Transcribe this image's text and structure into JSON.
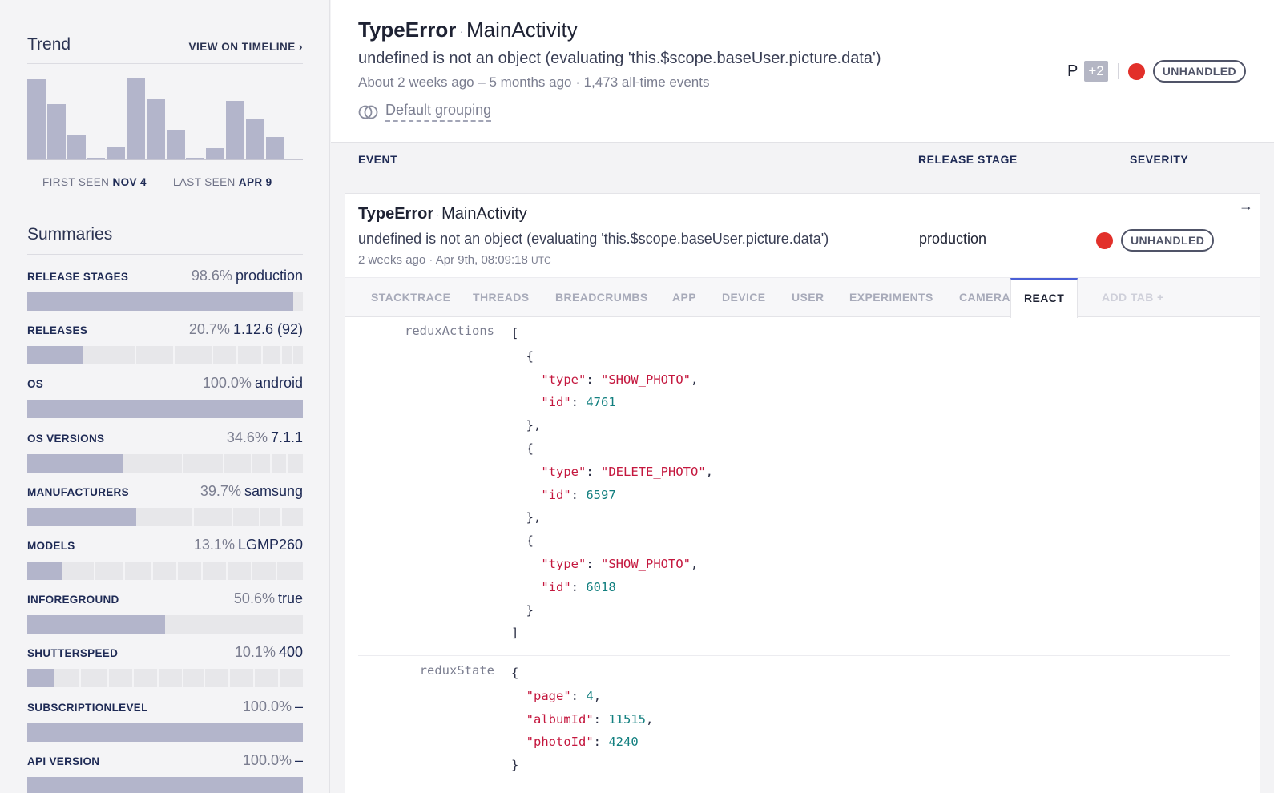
{
  "trend": {
    "title": "Trend",
    "timeline_link": "VIEW ON TIMELINE ›",
    "bars": [
      95,
      66,
      29,
      2,
      14,
      97,
      72,
      35,
      2,
      13,
      70,
      49,
      27
    ],
    "first_seen_label": "FIRST SEEN",
    "first_seen_value": "NOV 4",
    "last_seen_label": "LAST SEEN",
    "last_seen_value": "APR 9"
  },
  "summaries": {
    "title": "Summaries",
    "items": [
      {
        "label": "RELEASE STAGES",
        "pct": "98.6%",
        "value": "production",
        "fill": 0.965,
        "segments": []
      },
      {
        "label": "RELEASES",
        "pct": "20.7%",
        "value": "1.12.6 (92)",
        "fill": 0.2,
        "segments": [
          0.39,
          0.53,
          0.67,
          0.76,
          0.85,
          0.92,
          0.96
        ]
      },
      {
        "label": "OS",
        "pct": "100.0%",
        "value": "android",
        "fill": 1.0,
        "segments": []
      },
      {
        "label": "OS VERSIONS",
        "pct": "34.6%",
        "value": "7.1.1",
        "fill": 0.345,
        "segments": [
          0.56,
          0.71,
          0.81,
          0.88,
          0.94
        ]
      },
      {
        "label": "MANUFACTURERS",
        "pct": "39.7%",
        "value": "samsung",
        "fill": 0.395,
        "segments": [
          0.6,
          0.74,
          0.84,
          0.92
        ]
      },
      {
        "label": "MODELS",
        "pct": "13.1%",
        "value": "LGMP260",
        "fill": 0.125,
        "segments": [
          0.24,
          0.35,
          0.45,
          0.54,
          0.63,
          0.72,
          0.81,
          0.9
        ]
      },
      {
        "label": "INFOREGROUND",
        "pct": "50.6%",
        "value": "true",
        "fill": 0.5,
        "segments": []
      },
      {
        "label": "SHUTTERSPEED",
        "pct": "10.1%",
        "value": "400",
        "fill": 0.095,
        "segments": [
          0.19,
          0.29,
          0.38,
          0.47,
          0.56,
          0.64,
          0.73,
          0.82,
          0.91
        ]
      },
      {
        "label": "SUBSCRIPTIONLEVEL",
        "pct": "100.0%",
        "value": "–",
        "fill": 1.0,
        "segments": []
      },
      {
        "label": "API VERSION",
        "pct": "100.0%",
        "value": "–",
        "fill": 1.0,
        "segments": []
      }
    ]
  },
  "header": {
    "error_class": "TypeError",
    "context": "MainActivity",
    "message": "undefined is not an object (evaluating 'this.$scope.baseUser.picture.data')",
    "meta": "About 2 weeks ago – 5 months ago  ·  1,473 all-time events",
    "grouping": "Default grouping",
    "assignee_initial": "P",
    "assignee_more": "+2",
    "status": "UNHANDLED"
  },
  "columns": {
    "event": "EVENT",
    "release_stage": "RELEASE STAGE",
    "severity": "SEVERITY"
  },
  "event": {
    "error_class": "TypeError",
    "context": "MainActivity",
    "message": "undefined is not an object (evaluating 'this.$scope.baseUser.picture.data')",
    "time_ago": "2 weeks ago",
    "timestamp": "Apr 9th, 08:09:18",
    "tz": "UTC",
    "release_stage": "production",
    "status": "UNHANDLED",
    "arrow": "→"
  },
  "tabs": [
    "STACKTRACE",
    "THREADS",
    "BREADCRUMBS",
    "APP",
    "DEVICE",
    "USER",
    "EXPERIMENTS",
    "CAMERA",
    "REACT",
    "ADD TAB +"
  ],
  "active_tab": "REACT",
  "react": {
    "redux_actions_label": "reduxActions",
    "redux_actions": [
      {
        "type": "SHOW_PHOTO",
        "id": 4761
      },
      {
        "type": "DELETE_PHOTO",
        "id": 6597
      },
      {
        "type": "SHOW_PHOTO",
        "id": 6018
      }
    ],
    "redux_state_label": "reduxState",
    "redux_state": {
      "page": 4,
      "albumId": 11515,
      "photoId": 4240
    }
  },
  "colors": {
    "accent": "#4a5fd6",
    "severity_error": "#e2302a",
    "bar": "#b3b5cb"
  }
}
